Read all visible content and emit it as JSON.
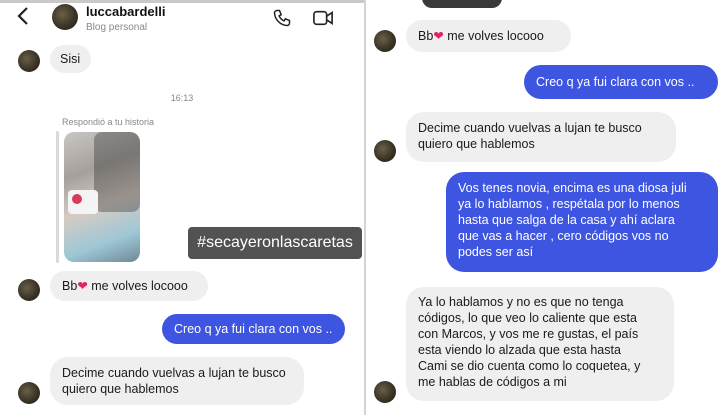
{
  "header": {
    "username": "luccabardelli",
    "subtitle": "Blog personal",
    "back_icon": "chevron-left-icon",
    "call_icon": "phone-icon",
    "video_icon": "video-icon"
  },
  "left": {
    "msg_sisi": "Sisi",
    "timestamp": "16:13",
    "reply_label": "Respondió a tu historia",
    "hashtag": "#secayeronlascaretas",
    "msg_bb_prefix": "Bb",
    "msg_bb_suffix": " me volves locooo",
    "msg_out_1": "Creo q ya fui clara con vos ..",
    "msg_lujan_1": "Decime cuando vuelvas a lujan te busco",
    "msg_lujan_2": "quiero que hablemos"
  },
  "right": {
    "msg_bb_prefix": "Bb",
    "msg_bb_suffix": " me volves locooo",
    "msg_out_1": "Creo q ya fui clara con vos ..",
    "msg_lujan_1": "Decime cuando vuelvas a lujan te busco",
    "msg_lujan_2": "quiero que hablemos",
    "msg_out_long": [
      "Vos tenes novia, encima es una diosa juli",
      "ya lo hablamos , respétala por lo menos",
      "hasta que salga de la casa y ahí aclara",
      "que vas a hacer , cero códigos vos no",
      "podes ser así"
    ],
    "msg_in_long": [
      "Ya lo hablamos y no es que no tenga",
      "códigos, lo que veo lo caliente que esta",
      "con Marcos, y vos me re gustas, el país",
      "esta viendo lo alzada que esta hasta",
      "Cami se dio cuenta como lo coquetea, y",
      "me hablas de códigos a mi"
    ]
  },
  "colors": {
    "outgoing_bubble": "#3d55e0",
    "incoming_bubble": "#efefef",
    "heart": "#e0245e"
  }
}
